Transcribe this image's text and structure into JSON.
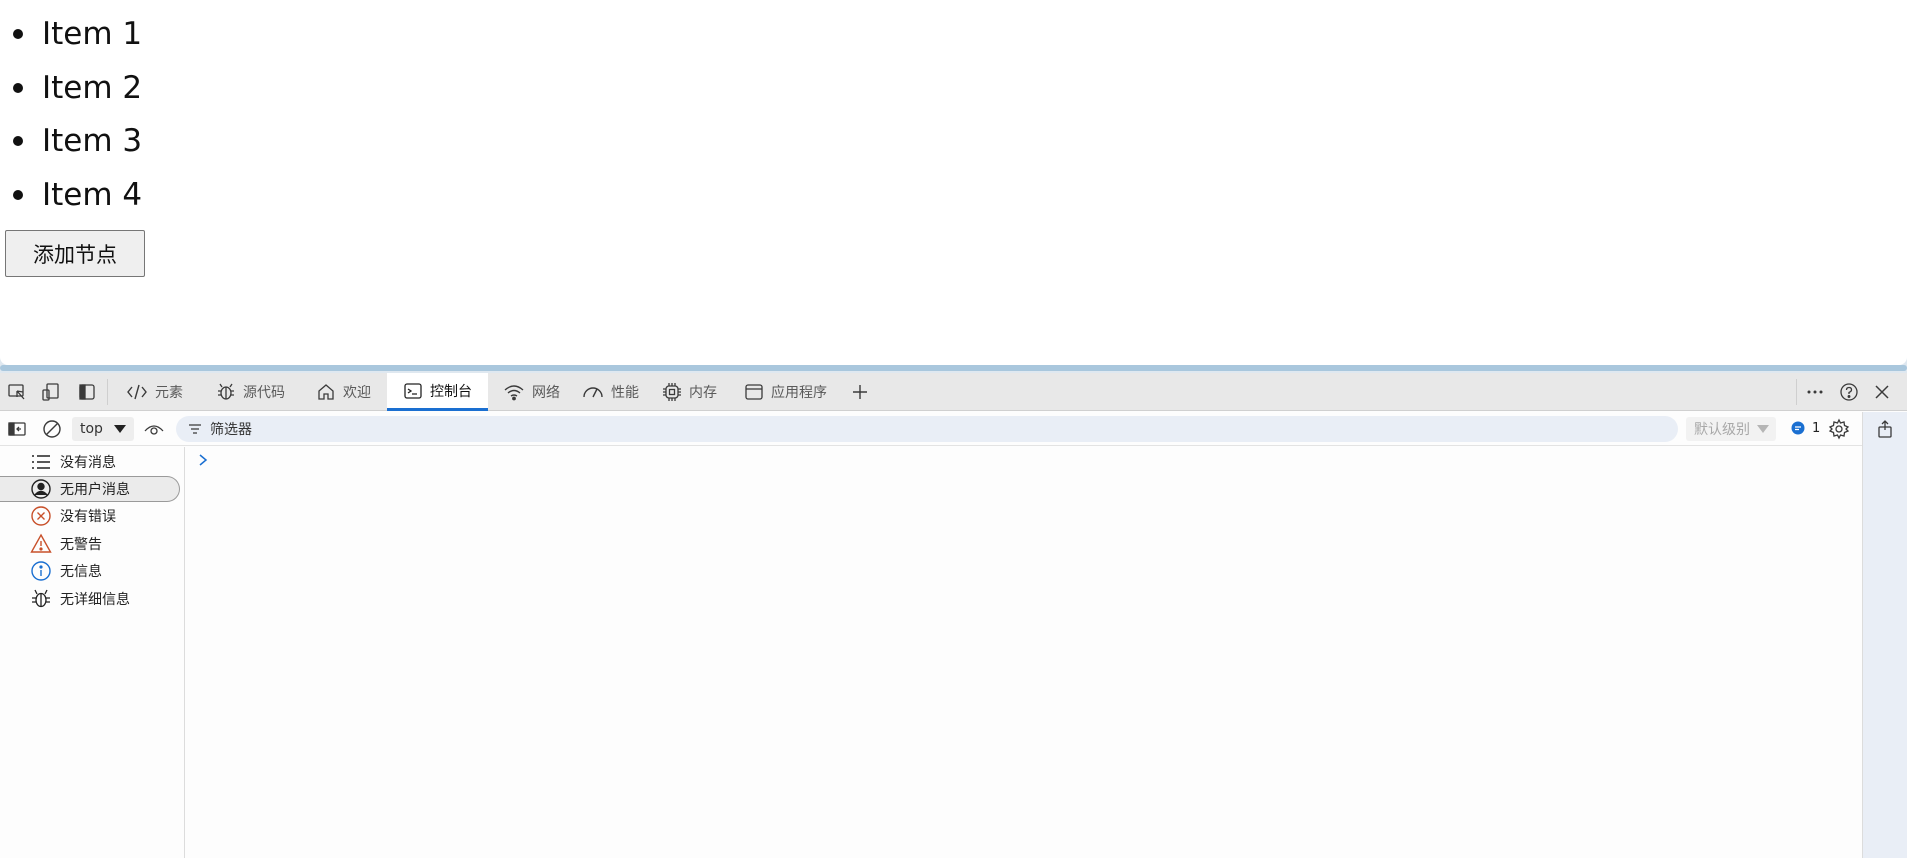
{
  "page": {
    "list_items": [
      "Item 1",
      "Item 2",
      "Item 3",
      "Item 4"
    ],
    "add_button_label": "添加节点"
  },
  "devtools": {
    "tabs": [
      {
        "label": "元素",
        "icon": "code-icon"
      },
      {
        "label": "源代码",
        "icon": "bug-icon"
      },
      {
        "label": "欢迎",
        "icon": "home-icon"
      },
      {
        "label": "控制台",
        "icon": "console-icon",
        "active": true
      },
      {
        "label": "网络",
        "icon": "wifi-icon"
      },
      {
        "label": "性能",
        "icon": "gauge-icon"
      },
      {
        "label": "内存",
        "icon": "chip-icon"
      },
      {
        "label": "应用程序",
        "icon": "window-icon"
      }
    ],
    "toolbar": {
      "context": "top",
      "filter_placeholder": "筛选器",
      "level": "默认级别",
      "message_count": "1"
    },
    "sidebar": [
      {
        "label": "没有消息",
        "icon": "list-icon"
      },
      {
        "label": "无用户消息",
        "icon": "user-icon",
        "selected": true
      },
      {
        "label": "没有错误",
        "icon": "error-icon"
      },
      {
        "label": "无警告",
        "icon": "warning-icon"
      },
      {
        "label": "无信息",
        "icon": "info-icon"
      },
      {
        "label": "无详细信息",
        "icon": "bug-icon"
      }
    ],
    "colors": {
      "accent": "#1a6fd1",
      "error": "#c8502a",
      "warning": "#c8502a",
      "info": "#1a6fd1"
    }
  }
}
